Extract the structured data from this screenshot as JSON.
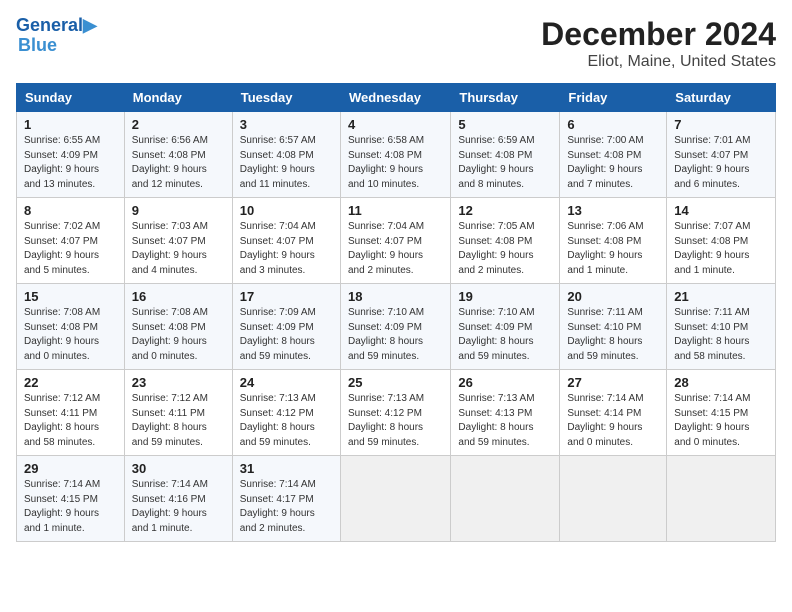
{
  "logo": {
    "line1": "General",
    "line2": "Blue"
  },
  "title": "December 2024",
  "subtitle": "Eliot, Maine, United States",
  "days_of_week": [
    "Sunday",
    "Monday",
    "Tuesday",
    "Wednesday",
    "Thursday",
    "Friday",
    "Saturday"
  ],
  "weeks": [
    [
      {
        "day": "1",
        "detail": "Sunrise: 6:55 AM\nSunset: 4:09 PM\nDaylight: 9 hours\nand 13 minutes."
      },
      {
        "day": "2",
        "detail": "Sunrise: 6:56 AM\nSunset: 4:08 PM\nDaylight: 9 hours\nand 12 minutes."
      },
      {
        "day": "3",
        "detail": "Sunrise: 6:57 AM\nSunset: 4:08 PM\nDaylight: 9 hours\nand 11 minutes."
      },
      {
        "day": "4",
        "detail": "Sunrise: 6:58 AM\nSunset: 4:08 PM\nDaylight: 9 hours\nand 10 minutes."
      },
      {
        "day": "5",
        "detail": "Sunrise: 6:59 AM\nSunset: 4:08 PM\nDaylight: 9 hours\nand 8 minutes."
      },
      {
        "day": "6",
        "detail": "Sunrise: 7:00 AM\nSunset: 4:08 PM\nDaylight: 9 hours\nand 7 minutes."
      },
      {
        "day": "7",
        "detail": "Sunrise: 7:01 AM\nSunset: 4:07 PM\nDaylight: 9 hours\nand 6 minutes."
      }
    ],
    [
      {
        "day": "8",
        "detail": "Sunrise: 7:02 AM\nSunset: 4:07 PM\nDaylight: 9 hours\nand 5 minutes."
      },
      {
        "day": "9",
        "detail": "Sunrise: 7:03 AM\nSunset: 4:07 PM\nDaylight: 9 hours\nand 4 minutes."
      },
      {
        "day": "10",
        "detail": "Sunrise: 7:04 AM\nSunset: 4:07 PM\nDaylight: 9 hours\nand 3 minutes."
      },
      {
        "day": "11",
        "detail": "Sunrise: 7:04 AM\nSunset: 4:07 PM\nDaylight: 9 hours\nand 2 minutes."
      },
      {
        "day": "12",
        "detail": "Sunrise: 7:05 AM\nSunset: 4:08 PM\nDaylight: 9 hours\nand 2 minutes."
      },
      {
        "day": "13",
        "detail": "Sunrise: 7:06 AM\nSunset: 4:08 PM\nDaylight: 9 hours\nand 1 minute."
      },
      {
        "day": "14",
        "detail": "Sunrise: 7:07 AM\nSunset: 4:08 PM\nDaylight: 9 hours\nand 1 minute."
      }
    ],
    [
      {
        "day": "15",
        "detail": "Sunrise: 7:08 AM\nSunset: 4:08 PM\nDaylight: 9 hours\nand 0 minutes."
      },
      {
        "day": "16",
        "detail": "Sunrise: 7:08 AM\nSunset: 4:08 PM\nDaylight: 9 hours\nand 0 minutes."
      },
      {
        "day": "17",
        "detail": "Sunrise: 7:09 AM\nSunset: 4:09 PM\nDaylight: 8 hours\nand 59 minutes."
      },
      {
        "day": "18",
        "detail": "Sunrise: 7:10 AM\nSunset: 4:09 PM\nDaylight: 8 hours\nand 59 minutes."
      },
      {
        "day": "19",
        "detail": "Sunrise: 7:10 AM\nSunset: 4:09 PM\nDaylight: 8 hours\nand 59 minutes."
      },
      {
        "day": "20",
        "detail": "Sunrise: 7:11 AM\nSunset: 4:10 PM\nDaylight: 8 hours\nand 59 minutes."
      },
      {
        "day": "21",
        "detail": "Sunrise: 7:11 AM\nSunset: 4:10 PM\nDaylight: 8 hours\nand 58 minutes."
      }
    ],
    [
      {
        "day": "22",
        "detail": "Sunrise: 7:12 AM\nSunset: 4:11 PM\nDaylight: 8 hours\nand 58 minutes."
      },
      {
        "day": "23",
        "detail": "Sunrise: 7:12 AM\nSunset: 4:11 PM\nDaylight: 8 hours\nand 59 minutes."
      },
      {
        "day": "24",
        "detail": "Sunrise: 7:13 AM\nSunset: 4:12 PM\nDaylight: 8 hours\nand 59 minutes."
      },
      {
        "day": "25",
        "detail": "Sunrise: 7:13 AM\nSunset: 4:12 PM\nDaylight: 8 hours\nand 59 minutes."
      },
      {
        "day": "26",
        "detail": "Sunrise: 7:13 AM\nSunset: 4:13 PM\nDaylight: 8 hours\nand 59 minutes."
      },
      {
        "day": "27",
        "detail": "Sunrise: 7:14 AM\nSunset: 4:14 PM\nDaylight: 9 hours\nand 0 minutes."
      },
      {
        "day": "28",
        "detail": "Sunrise: 7:14 AM\nSunset: 4:15 PM\nDaylight: 9 hours\nand 0 minutes."
      }
    ],
    [
      {
        "day": "29",
        "detail": "Sunrise: 7:14 AM\nSunset: 4:15 PM\nDaylight: 9 hours\nand 1 minute."
      },
      {
        "day": "30",
        "detail": "Sunrise: 7:14 AM\nSunset: 4:16 PM\nDaylight: 9 hours\nand 1 minute."
      },
      {
        "day": "31",
        "detail": "Sunrise: 7:14 AM\nSunset: 4:17 PM\nDaylight: 9 hours\nand 2 minutes."
      },
      null,
      null,
      null,
      null
    ]
  ]
}
